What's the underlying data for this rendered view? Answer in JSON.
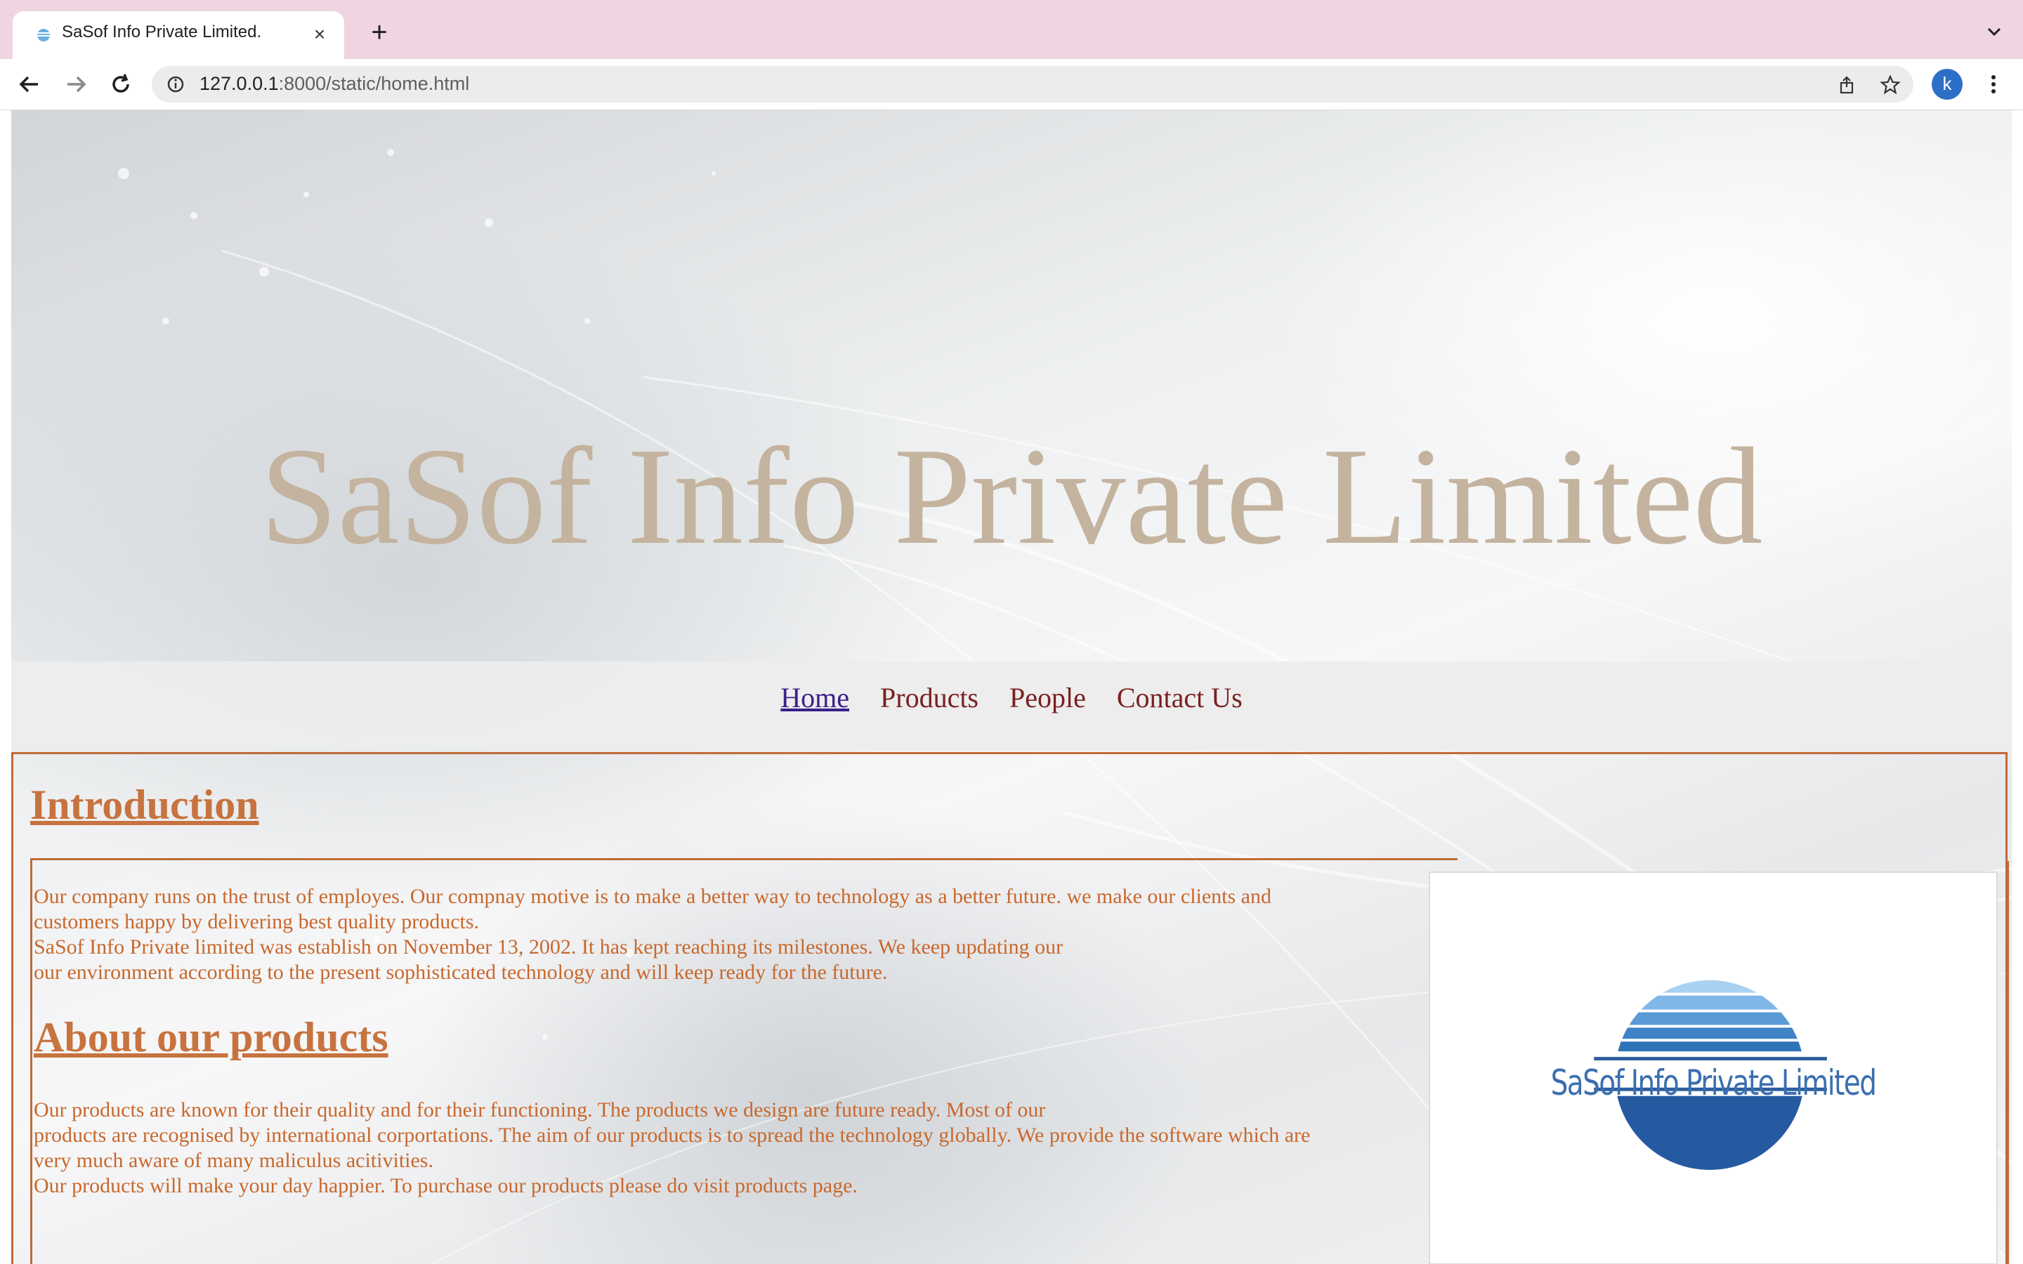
{
  "browser": {
    "tab_title": "SaSof Info Private Limited.",
    "tab_close_glyph": "×",
    "new_tab_glyph": "+",
    "url_host": "127.0.0.1",
    "url_path": ":8000/static/home.html",
    "avatar_letter": "k",
    "icons": [
      "back-icon",
      "forward-icon",
      "reload-icon",
      "info-icon",
      "share-icon",
      "star-icon",
      "menu-icon",
      "tab-list-icon"
    ]
  },
  "banner": {
    "title": "SaSof Info Private Limited",
    "title_color": "#c4b39e"
  },
  "nav": {
    "items": [
      {
        "label": "Home"
      },
      {
        "label": "Products"
      },
      {
        "label": "People"
      },
      {
        "label": "Contact Us"
      }
    ],
    "link_color": "#7a1f1f",
    "current_color": "#3b1f8a"
  },
  "content": {
    "intro_heading": "Introduction",
    "intro_lines": [
      "Our company runs on the trust of employes. Our compnay motive is to make a better way to technology as a better future. we make our clients and",
      "customers happy by delivering best quality products.",
      "SaSof Info Private limited was establish on November 13, 2002. It has kept reaching its milestones. We keep updating our",
      "our environment according to the present sophisticated technology and will keep ready for the future."
    ],
    "products_heading": "About our products",
    "products_lines": [
      "Our products are known for their quality and for their functioning. The products we design are future ready. Most of our",
      "products are recognised by international corportations. The aim of our products is to spread the technology globally. We provide the software which are",
      "very much aware of many maliculus acitivities.",
      "Our products will make your day happier. To purchase our products please do visit products page."
    ],
    "text_color": "#c9682c",
    "border_color": "#c06a38"
  },
  "logo": {
    "text": "SaSof Info Private Limited",
    "colors": [
      "#8ec3ec",
      "#5a9ad6",
      "#2d6fb0",
      "#2559a0"
    ]
  }
}
